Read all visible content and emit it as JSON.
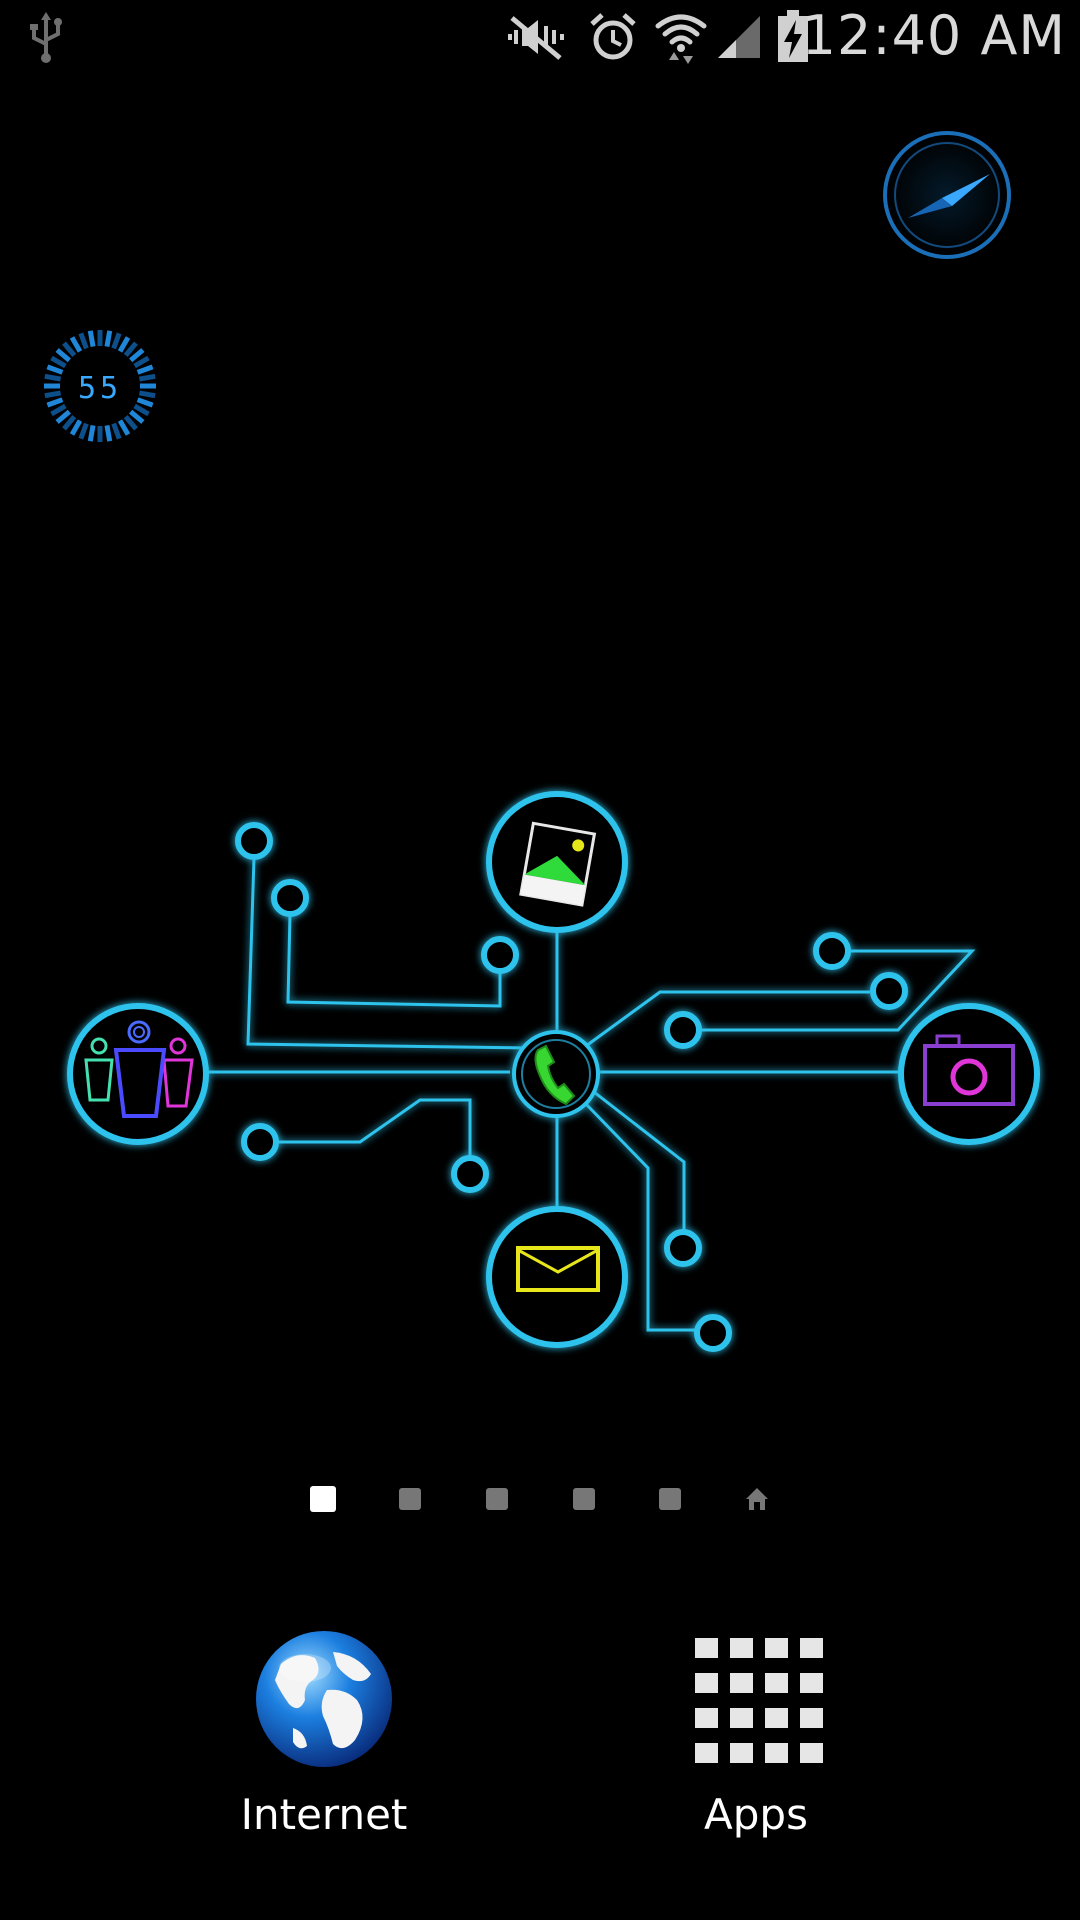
{
  "status_bar": {
    "time": "12:40 AM",
    "icons": [
      "usb-icon",
      "mute-icon",
      "alarm-icon",
      "wifi-icon",
      "signal-icon",
      "battery-charging-icon"
    ]
  },
  "widgets": {
    "compass": {
      "icon": "compass-icon"
    },
    "battery_level": {
      "value": "55"
    }
  },
  "home_apps": {
    "gallery": {
      "icon": "gallery-icon"
    },
    "contacts": {
      "icon": "contacts-icon"
    },
    "phone": {
      "icon": "phone-icon"
    },
    "camera": {
      "icon": "camera-icon"
    },
    "messages": {
      "icon": "envelope-icon"
    }
  },
  "page_indicator": {
    "pages": 6,
    "current": 1,
    "last_is_home": true
  },
  "dock": {
    "internet": {
      "label": "Internet",
      "icon": "globe-icon"
    },
    "apps": {
      "label": "Apps",
      "icon": "apps-grid-icon"
    }
  },
  "colors": {
    "neon_blue": "#2fc3ec",
    "phone_green": "#38d630",
    "mail_yellow": "#e6e61a",
    "camera_purple": "#8a3fd1",
    "camera_magenta": "#e035d8"
  }
}
